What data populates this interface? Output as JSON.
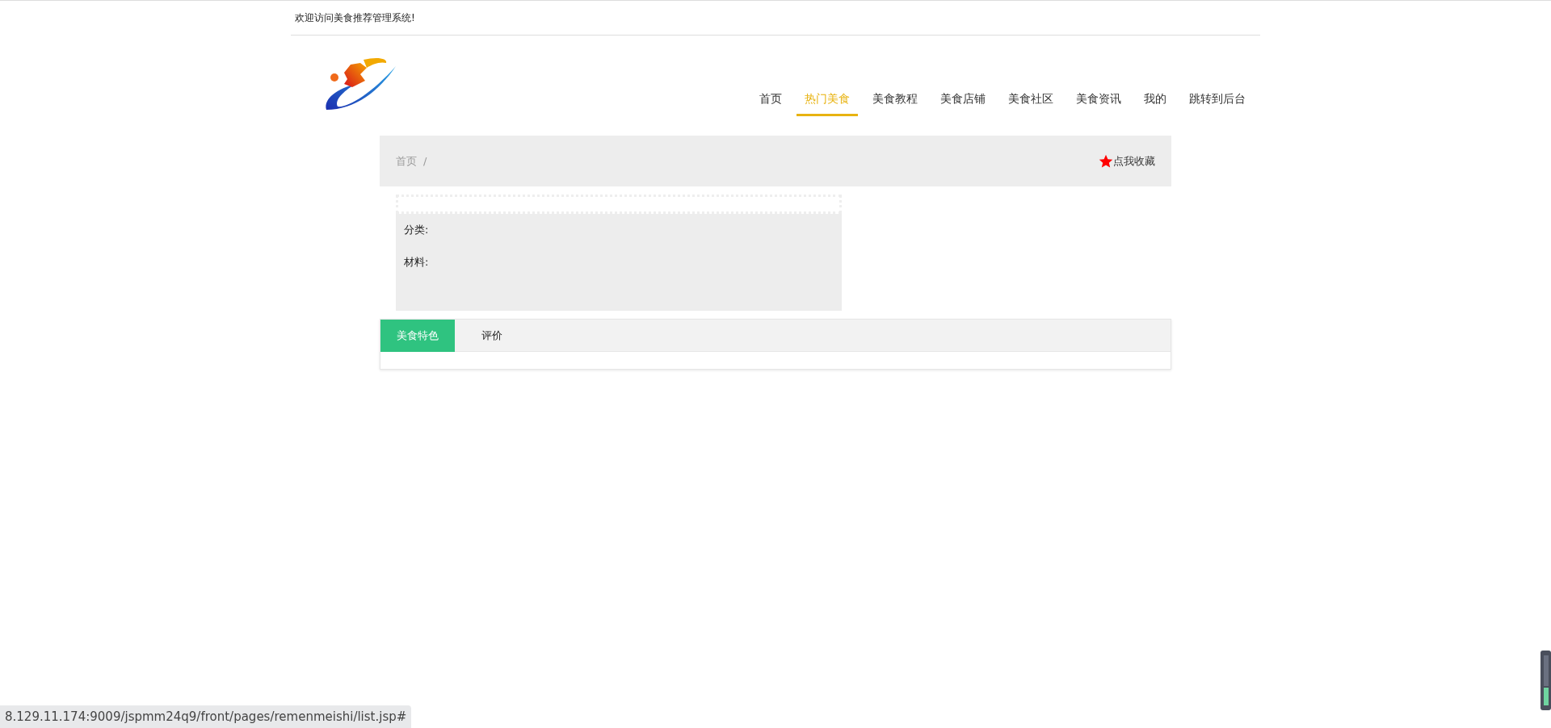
{
  "top_bar": {
    "welcome": "欢迎访问美食推荐管理系统!"
  },
  "nav": [
    {
      "label": "首页",
      "selected": false
    },
    {
      "label": "热门美食",
      "selected": true
    },
    {
      "label": "美食教程",
      "selected": false
    },
    {
      "label": "美食店铺",
      "selected": false
    },
    {
      "label": "美食社区",
      "selected": false
    },
    {
      "label": "美食资讯",
      "selected": false
    },
    {
      "label": "我的",
      "selected": false
    },
    {
      "label": "跳转到后台",
      "selected": false
    }
  ],
  "breadcrumb": {
    "items": [
      "首页"
    ],
    "separator": "/",
    "favorite": "点我收藏"
  },
  "detail": {
    "fields": [
      "分类:",
      "材料:"
    ]
  },
  "tabs": [
    {
      "label": "美食特色",
      "selected": true
    },
    {
      "label": "评价",
      "selected": false
    }
  ],
  "status_url": "8.129.11.174:9009/jspmm24q9/front/pages/remenmeishi/list.jsp#"
}
